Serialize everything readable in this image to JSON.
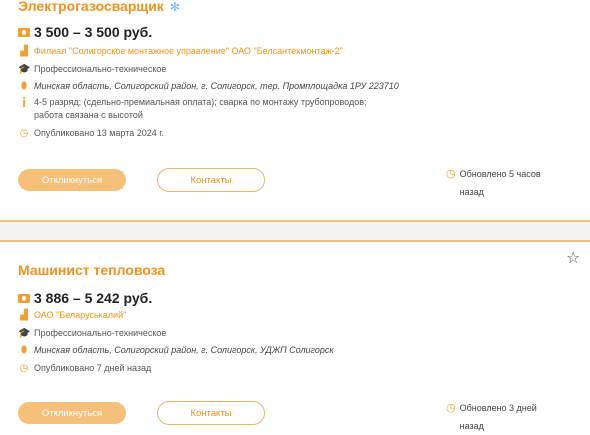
{
  "vacancy1": {
    "title": "Электрогазосварщик",
    "salary": "3 500 – 3 500 руб.",
    "employer": "Филиал \"Солигорское монтажное управление\" ОАО \"Белсантехмонтаж-2\"",
    "education": "Профессионально-техническое",
    "address": "Минская область, Солигорский район, г. Солигорск, тер. Промплощадка 1РУ 223710",
    "info_line1": "4-5 разряд; (сдельно-премиальная оплата); сварка по монтажу трубопроводов;",
    "info_line2": "работа связана с высотой",
    "published": "Опубликовано 13 марта 2024 г.",
    "respond_label": "Откликнуться",
    "contacts_label": "Контакты",
    "updated_line1": "Обновлено 5 часов",
    "updated_line2": "назад"
  },
  "vacancy2": {
    "title": "Машинист тепловоза",
    "salary": "3 886 – 5 242 руб.",
    "employer": "ОАО \"Беларуськалий\"",
    "education": "Профессионально-техническое",
    "address": "Минская область, Солигорский район, г. Солигорск, УДЖП Солигорск",
    "published": "Опубликовано 7 дней назад",
    "respond_label": "Откликнуться",
    "contacts_label": "Контакты",
    "updated_line1": "Обновлено 3 дней",
    "updated_line2": "назад"
  },
  "icons": {
    "money": "money-icon",
    "employer": "factory-icon",
    "education": "graduation-cap-icon",
    "location": "location-pin-icon",
    "info": "info-icon",
    "clock": "clock-icon",
    "star": "star-outline-icon",
    "snowflake": "snowflake-icon"
  },
  "colors": {
    "accent": "#f0931e",
    "button": "#f5c07a",
    "border": "#f2c27c"
  }
}
